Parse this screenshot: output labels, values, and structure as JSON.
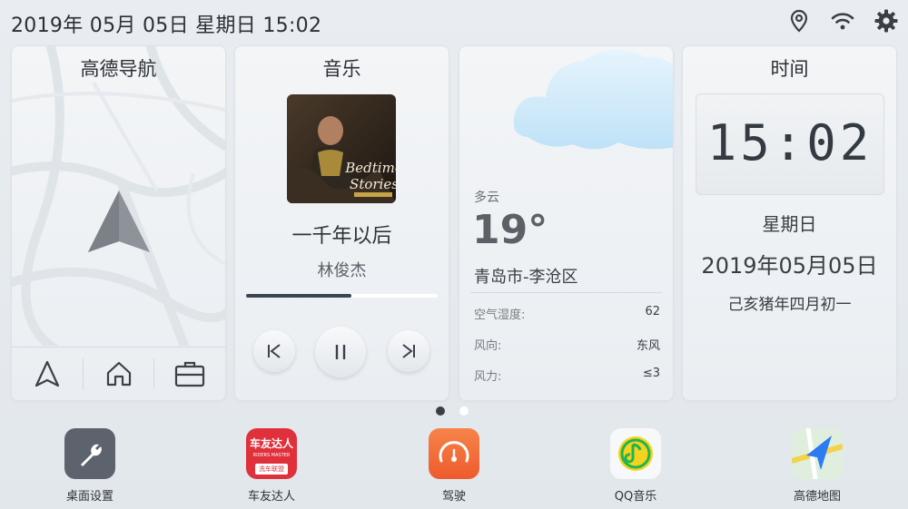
{
  "status_bar": {
    "datetime": "2019年 05月 05日 星期日 15:02",
    "icons": [
      "location-pin-icon",
      "wifi-icon",
      "gear-icon"
    ]
  },
  "navigation_card": {
    "title": "高德导航",
    "bottom_buttons": [
      "navigate-arrow-icon",
      "home-icon",
      "briefcase-icon"
    ]
  },
  "music_card": {
    "title": "音乐",
    "song": "一千年以后",
    "artist": "林俊杰",
    "album_cover_text_line1": "Bedtime",
    "album_cover_text_line2": "Stories",
    "progress_fraction": 0.55,
    "controls": [
      "previous-icon",
      "pause-icon",
      "next-icon"
    ]
  },
  "weather_card": {
    "condition": "多云",
    "temperature": "19°",
    "city": "青岛市-李沧区",
    "details": [
      {
        "label": "空气湿度:",
        "value": "62"
      },
      {
        "label": "风向:",
        "value": "东风"
      },
      {
        "label": "风力:",
        "value": "≤3"
      }
    ]
  },
  "time_card": {
    "title": "时间",
    "clock": "15:02",
    "weekday": "星期日",
    "date": "2019年05月05日",
    "lunar": "己亥猪年四月初一"
  },
  "pager": {
    "pages": 2,
    "active": 0
  },
  "dock": [
    {
      "label": "桌面设置",
      "icon": "wrench-icon",
      "color": "#5d636c"
    },
    {
      "label": "车友达人",
      "icon": "car-club-icon",
      "color": "#e0303c",
      "icon_text_line1": "车友达人",
      "icon_text_line2": "RIDERS MASTER",
      "icon_text_line3": "洗车联盟"
    },
    {
      "label": "驾驶",
      "icon": "speedometer-icon",
      "color": "#f26b3a"
    },
    {
      "label": "QQ音乐",
      "icon": "qq-music-icon",
      "color": "#f5d21f"
    },
    {
      "label": "高德地图",
      "icon": "amap-icon",
      "color": "#2d7bf2"
    }
  ]
}
